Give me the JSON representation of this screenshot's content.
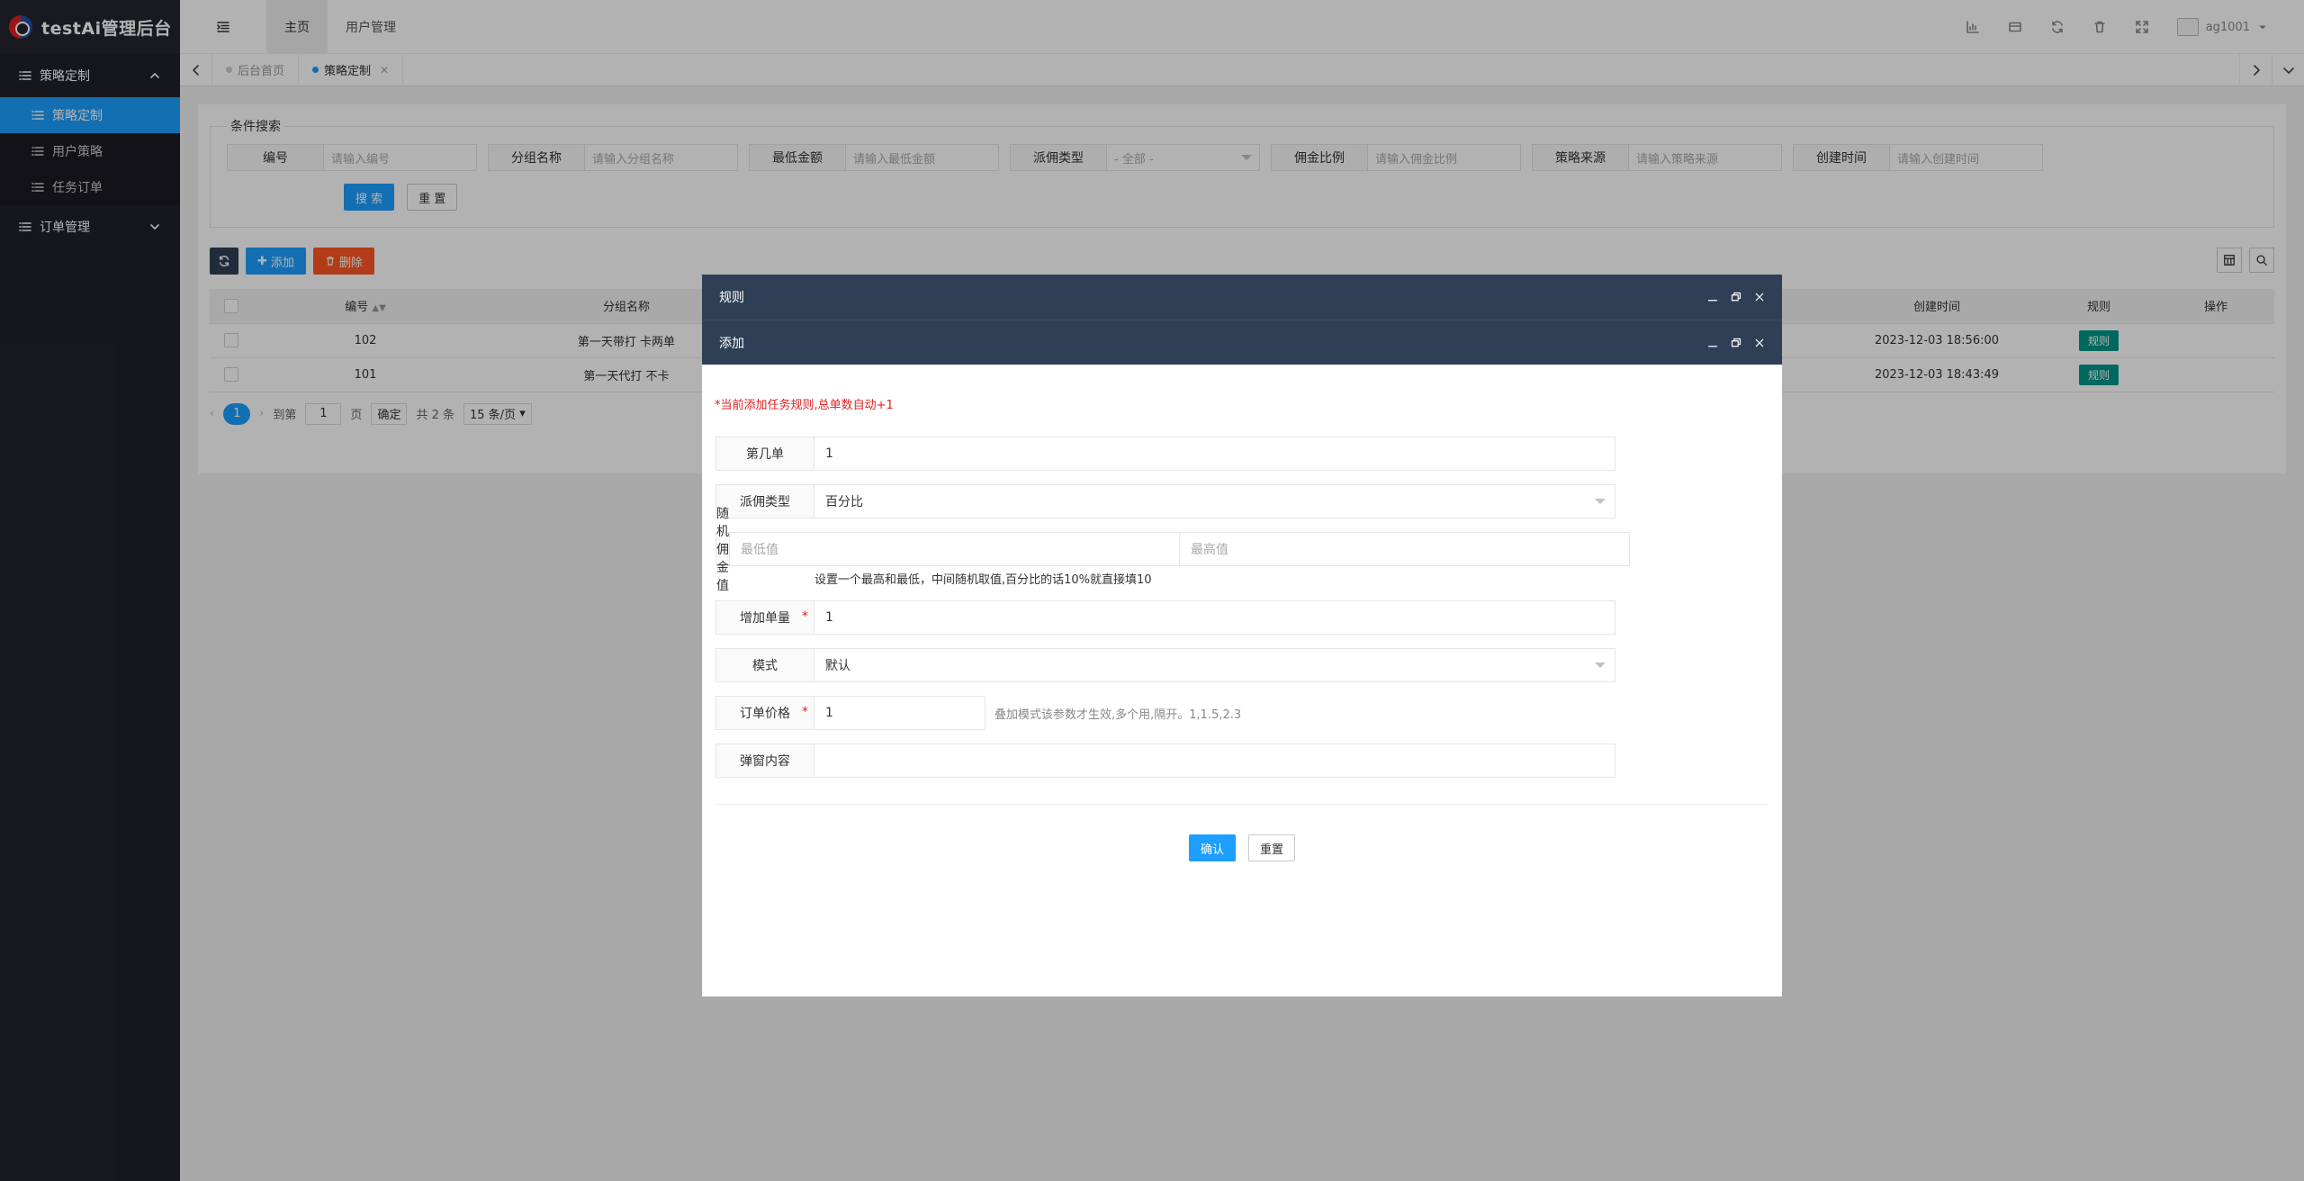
{
  "app": {
    "title": "testAi管理后台"
  },
  "sidebar": {
    "groups": [
      {
        "label": "策略定制",
        "items": [
          {
            "label": "策略定制",
            "active": true
          },
          {
            "label": "用户策略",
            "active": false
          },
          {
            "label": "任务订单",
            "active": false
          }
        ]
      },
      {
        "label": "订单管理",
        "items": []
      }
    ]
  },
  "topbar": {
    "tabs": [
      {
        "label": "主页"
      },
      {
        "label": "用户管理"
      }
    ],
    "user": "ag1001"
  },
  "page_tabs": [
    {
      "label": "后台首页"
    },
    {
      "label": "策略定制"
    }
  ],
  "search": {
    "legend": "条件搜索",
    "filters": [
      {
        "label": "编号",
        "placeholder": "请输入编号"
      },
      {
        "label": "分组名称",
        "placeholder": "请输入分组名称"
      },
      {
        "label": "最低金额",
        "placeholder": "请输入最低金额"
      },
      {
        "label": "派佣类型",
        "placeholder": "- 全部 -"
      },
      {
        "label": "佣金比例",
        "placeholder": "请输入佣金比例"
      },
      {
        "label": "策略来源",
        "placeholder": "请输入策略来源"
      },
      {
        "label": "创建时间",
        "placeholder": "请输入创建时间"
      }
    ],
    "search_btn": "搜 索",
    "reset_btn": "重 置"
  },
  "toolbar": {
    "add": "添加",
    "delete": "删除"
  },
  "table": {
    "headers": {
      "id": "编号",
      "group": "分组名称",
      "created": "创建时间",
      "rule": "规则",
      "op": "操作"
    },
    "rows": [
      {
        "id": "102",
        "group": "第一天带打 卡两单",
        "created": "2023-12-03 18:56:00",
        "rule": "规则"
      },
      {
        "id": "101",
        "group": "第一天代打 不卡",
        "created": "2023-12-03 18:43:49",
        "rule": "规则"
      }
    ]
  },
  "pager": {
    "current": "1",
    "goto_label": "到第",
    "goto_value": "1",
    "page_label": "页",
    "confirm": "确定",
    "total": "共 2 条",
    "per_page": "15 条/页"
  },
  "dialogs": {
    "outer_title": "规则",
    "inner_title": "添加",
    "notice": "*当前添加任务规则,总单数自动+1",
    "form": {
      "order_no": {
        "label": "第几单",
        "value": "1"
      },
      "commission_type": {
        "label": "派佣类型",
        "value": "百分比"
      },
      "random_commission": {
        "label": "随机佣金值",
        "min_placeholder": "最低值",
        "max_placeholder": "最高值",
        "hint": "设置一个最高和最低，中间随机取值,百分比的话10%就直接填10"
      },
      "add_qty": {
        "label": "增加单量",
        "value": "1"
      },
      "mode": {
        "label": "模式",
        "value": "默认"
      },
      "order_price": {
        "label": "订单价格",
        "value": "1",
        "hint": "叠加模式该参数才生效,多个用,隔开。1,1.5,2.3"
      },
      "popup_content": {
        "label": "弹窗内容",
        "value": ""
      }
    },
    "confirm": "确认",
    "reset": "重置"
  }
}
